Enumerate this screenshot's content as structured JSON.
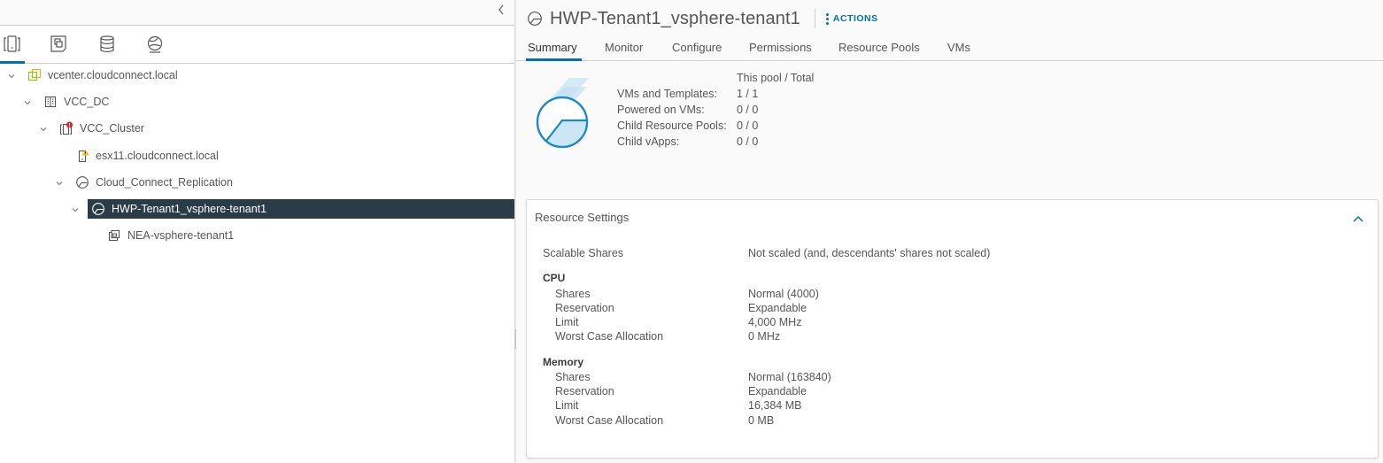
{
  "navigator": {
    "collapse_icon": "chevron-left-icon",
    "tabs": [
      {
        "name": "hosts-and-clusters",
        "icon": "hosts-clusters-icon",
        "active": true
      },
      {
        "name": "vms-and-templates",
        "icon": "vms-templates-icon",
        "active": false
      },
      {
        "name": "storage",
        "icon": "database-icon",
        "active": false
      },
      {
        "name": "networking",
        "icon": "network-icon",
        "active": false
      }
    ],
    "tree": [
      {
        "label": "vcenter.cloudconnect.local",
        "icon": "vcenter-icon",
        "expanded": true,
        "level": 0
      },
      {
        "label": "VCC_DC",
        "icon": "datacenter-icon",
        "expanded": true,
        "level": 1
      },
      {
        "label": "VCC_Cluster",
        "icon": "cluster-alert-icon",
        "expanded": true,
        "level": 2
      },
      {
        "label": "esx11.cloudconnect.local",
        "icon": "host-warning-icon",
        "expanded": null,
        "level": 3
      },
      {
        "label": "Cloud_Connect_Replication",
        "icon": "resource-pool-icon",
        "expanded": true,
        "level": 3
      },
      {
        "label": "HWP-Tenant1_vsphere-tenant1",
        "icon": "resource-pool-icon",
        "expanded": true,
        "level": 4,
        "selected": true
      },
      {
        "label": "NEA-vsphere-tenant1",
        "icon": "vm-folder-icon",
        "expanded": null,
        "level": 5
      }
    ]
  },
  "header": {
    "title": "HWP-Tenant1_vsphere-tenant1",
    "icon": "resource-pool-icon",
    "actions_label": "ACTIONS"
  },
  "tabs": [
    {
      "label": "Summary",
      "active": true
    },
    {
      "label": "Monitor",
      "active": false
    },
    {
      "label": "Configure",
      "active": false
    },
    {
      "label": "Permissions",
      "active": false
    },
    {
      "label": "Resource Pools",
      "active": false
    },
    {
      "label": "VMs",
      "active": false
    }
  ],
  "summary": {
    "column_header": "This pool / Total",
    "stats": [
      {
        "label": "VMs and Templates:",
        "value": "1 / 1"
      },
      {
        "label": "Powered on VMs:",
        "value": "0 / 0"
      },
      {
        "label": "Child Resource Pools:",
        "value": "0 / 0"
      },
      {
        "label": "Child vApps:",
        "value": "0 / 0"
      }
    ]
  },
  "resource_settings": {
    "title": "Resource Settings",
    "collapse_icon": "chevron-up-icon",
    "scalable_shares": {
      "label": "Scalable Shares",
      "value": "Not scaled (and, descendants' shares not scaled)"
    },
    "cpu": {
      "title": "CPU",
      "rows": [
        {
          "label": "Shares",
          "value": "Normal (4000)"
        },
        {
          "label": "Reservation",
          "value": "Expandable"
        },
        {
          "label": "Limit",
          "value": "4,000 MHz"
        },
        {
          "label": "Worst Case Allocation",
          "value": "0 MHz"
        }
      ]
    },
    "memory": {
      "title": "Memory",
      "rows": [
        {
          "label": "Shares",
          "value": "Normal (163840)"
        },
        {
          "label": "Reservation",
          "value": "Expandable"
        },
        {
          "label": "Limit",
          "value": "16,384 MB"
        },
        {
          "label": "Worst Case Allocation",
          "value": "0 MB"
        }
      ]
    }
  },
  "colors": {
    "accent": "#0072a3",
    "selected_row_bg": "#2a3c48",
    "text": "#565656"
  }
}
